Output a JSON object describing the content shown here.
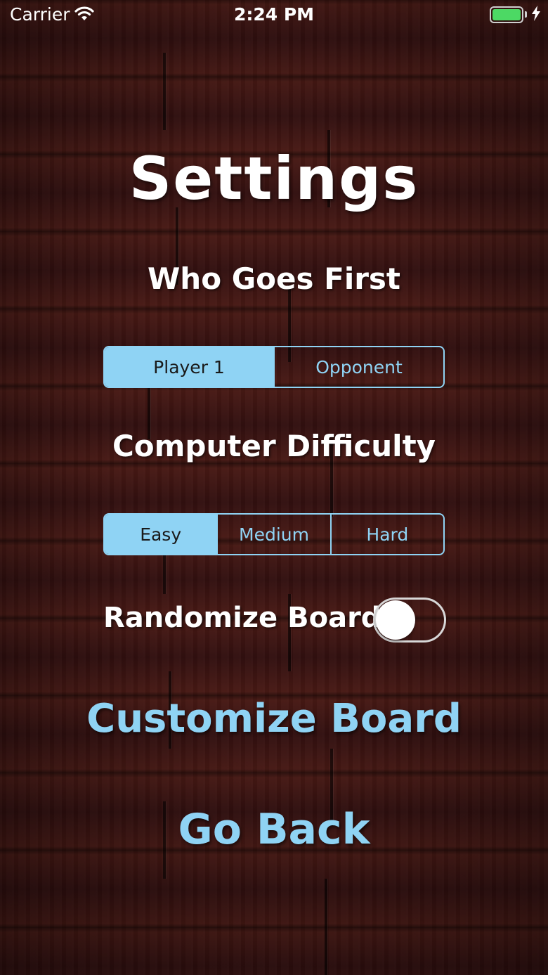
{
  "status_bar": {
    "carrier": "Carrier",
    "time": "2:24 PM",
    "wifi_icon": "wifi-icon",
    "battery_icon": "battery-charging-icon",
    "battery_level": 1.0
  },
  "screen": {
    "title": "Settings"
  },
  "first_player": {
    "heading": "Who Goes First",
    "options": [
      "Player 1",
      "Opponent"
    ],
    "selected": "Player 1"
  },
  "difficulty": {
    "heading": "Computer Difficulty",
    "options": [
      "Easy",
      "Medium",
      "Hard"
    ],
    "selected": "Easy"
  },
  "randomize": {
    "label": "Randomize Board:",
    "on": false
  },
  "actions": {
    "customize": "Customize Board",
    "back": "Go Back"
  },
  "colors": {
    "accent": "#8fd3f4",
    "text": "#ffffff",
    "wood": "#3a1411",
    "battery": "#4cd964"
  }
}
